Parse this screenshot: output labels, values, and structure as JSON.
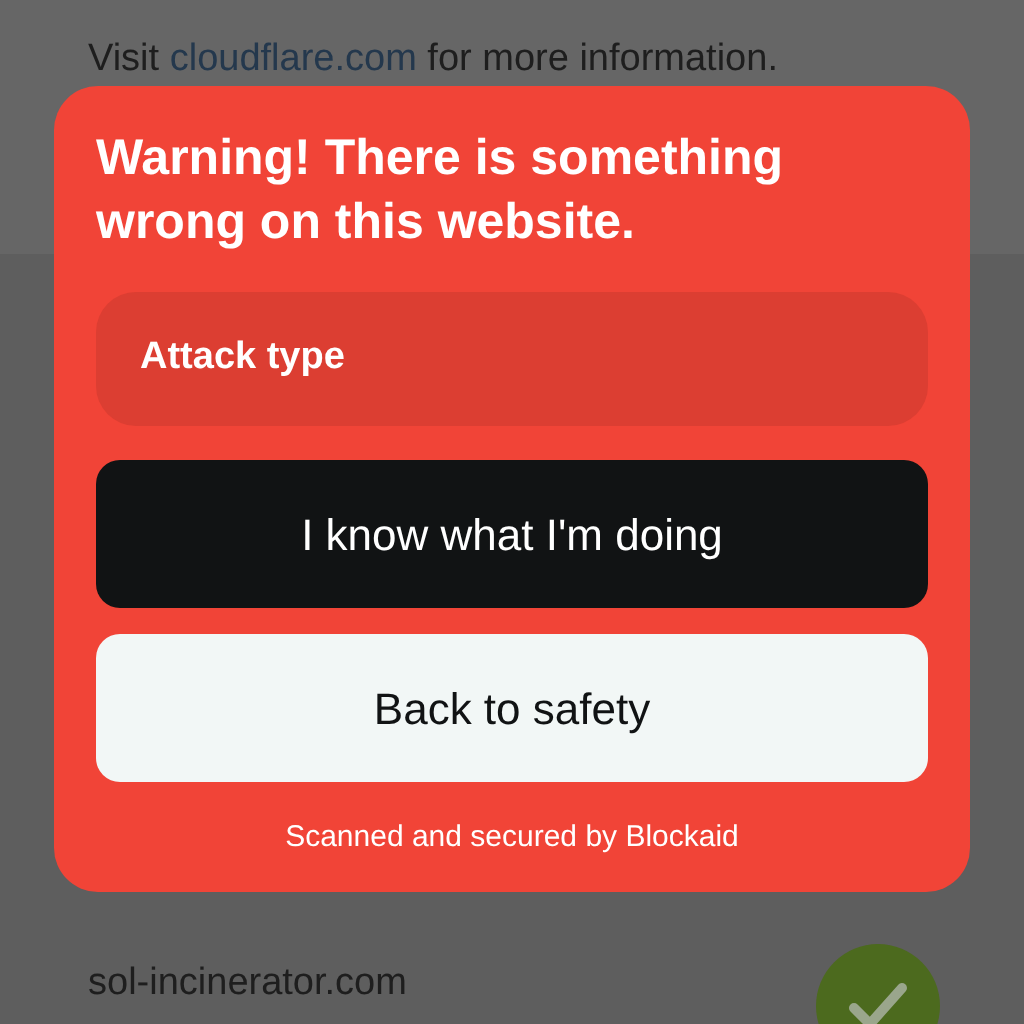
{
  "background": {
    "notice": {
      "before": "Visit ",
      "link": "cloudflare.com",
      "after": " for more information."
    },
    "site": {
      "domain": "sol-incinerator.com",
      "verified": true
    }
  },
  "warning": {
    "title": "Warning! There is something wrong on this website.",
    "attack_field": "Attack type",
    "buttons": [
      {
        "label": "I know what I'm doing",
        "kind": "proceed"
      },
      {
        "label": "Back to safety",
        "kind": "safe"
      }
    ],
    "footer": "Scanned and secured by Blockaid"
  }
}
